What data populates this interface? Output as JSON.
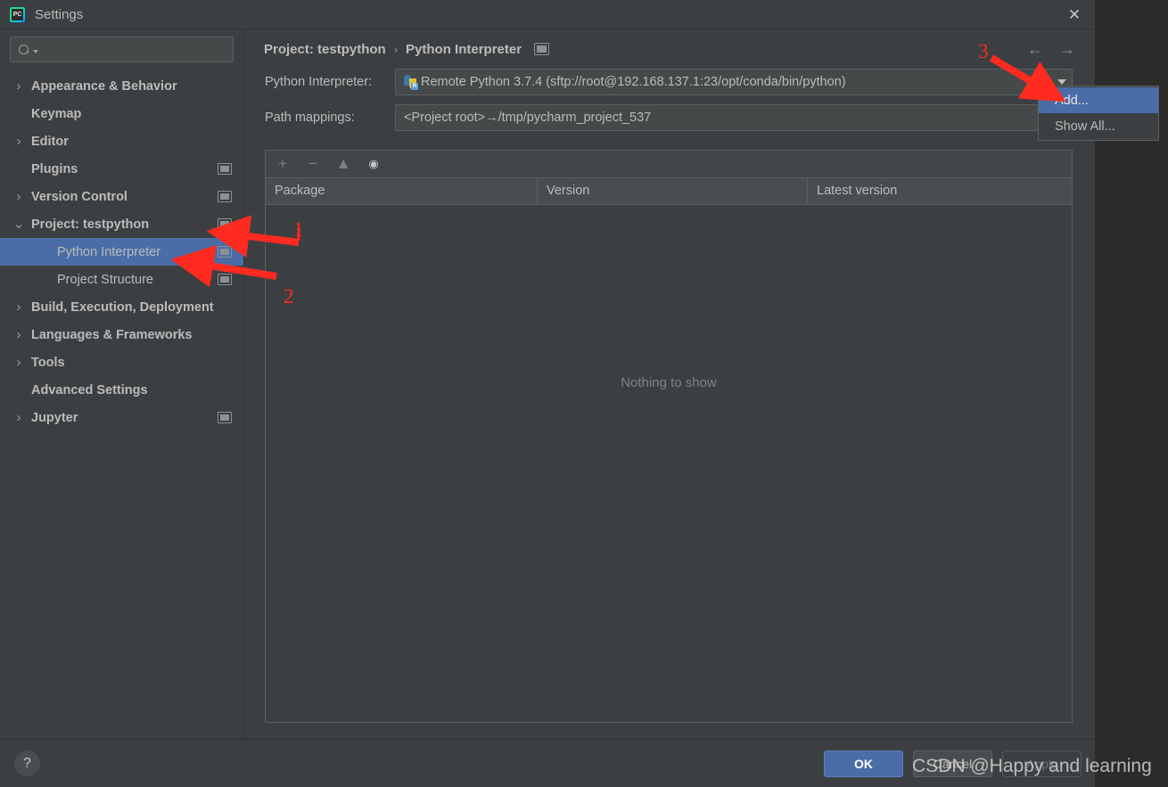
{
  "window": {
    "title": "Settings",
    "app_icon": "pycharm-icon",
    "close_icon": "close-icon"
  },
  "sidebar": {
    "search": {
      "value": "",
      "placeholder": "",
      "icon": "search-icon"
    },
    "items": [
      {
        "label": "Appearance & Behavior",
        "expandable": true,
        "expanded": false,
        "bold": true,
        "indent": 0,
        "badge": false,
        "selected": false
      },
      {
        "label": "Keymap",
        "expandable": false,
        "expanded": false,
        "bold": true,
        "indent": 0,
        "badge": false,
        "selected": false
      },
      {
        "label": "Editor",
        "expandable": true,
        "expanded": false,
        "bold": true,
        "indent": 0,
        "badge": false,
        "selected": false
      },
      {
        "label": "Plugins",
        "expandable": false,
        "expanded": false,
        "bold": true,
        "indent": 0,
        "badge": true,
        "selected": false
      },
      {
        "label": "Version Control",
        "expandable": true,
        "expanded": false,
        "bold": true,
        "indent": 0,
        "badge": true,
        "selected": false
      },
      {
        "label": "Project: testpython",
        "expandable": true,
        "expanded": true,
        "bold": true,
        "indent": 0,
        "badge": true,
        "selected": false
      },
      {
        "label": "Python Interpreter",
        "expandable": false,
        "expanded": false,
        "bold": false,
        "indent": 1,
        "badge": true,
        "selected": true
      },
      {
        "label": "Project Structure",
        "expandable": false,
        "expanded": false,
        "bold": false,
        "indent": 1,
        "badge": true,
        "selected": false
      },
      {
        "label": "Build, Execution, Deployment",
        "expandable": true,
        "expanded": false,
        "bold": true,
        "indent": 0,
        "badge": false,
        "selected": false
      },
      {
        "label": "Languages & Frameworks",
        "expandable": true,
        "expanded": false,
        "bold": true,
        "indent": 0,
        "badge": false,
        "selected": false
      },
      {
        "label": "Tools",
        "expandable": true,
        "expanded": false,
        "bold": true,
        "indent": 0,
        "badge": false,
        "selected": false
      },
      {
        "label": "Advanced Settings",
        "expandable": false,
        "expanded": false,
        "bold": true,
        "indent": 0,
        "badge": false,
        "selected": false
      },
      {
        "label": "Jupyter",
        "expandable": true,
        "expanded": false,
        "bold": true,
        "indent": 0,
        "badge": true,
        "selected": false
      }
    ]
  },
  "content": {
    "breadcrumb": {
      "project": "Project: testpython",
      "separator": "›",
      "page": "Python Interpreter"
    },
    "nav": {
      "back_icon": "arrow-left-icon",
      "forward_icon": "arrow-right-icon"
    },
    "interpreter": {
      "label": "Python Interpreter:",
      "value": "Remote Python 3.7.4 (sftp://root@192.168.137.1:23/opt/conda/bin/python)"
    },
    "path_mappings": {
      "label": "Path mappings:",
      "value": "<Project root>→/tmp/pycharm_project_537"
    },
    "packages": {
      "toolbar": [
        {
          "name": "add-package-icon",
          "glyph": "+"
        },
        {
          "name": "remove-package-icon",
          "glyph": "−"
        },
        {
          "name": "upgrade-package-icon",
          "glyph": "▲"
        },
        {
          "name": "show-early-releases-icon",
          "glyph": "◉"
        }
      ],
      "columns": [
        "Package",
        "Version",
        "Latest version"
      ],
      "rows": [],
      "empty_text": "Nothing to show"
    }
  },
  "popup": {
    "items": [
      {
        "label": "Add...",
        "highlighted": true
      },
      {
        "label": "Show All...",
        "highlighted": false
      }
    ]
  },
  "footer": {
    "help_label": "?",
    "ok_label": "OK",
    "cancel_label": "Cancel",
    "apply_label": "Apply"
  },
  "annotations": {
    "numbers": [
      "1",
      "2",
      "3"
    ],
    "color": "#ff2a20"
  },
  "watermark": {
    "text": "CSDN @Happy and learning"
  },
  "colors": {
    "window_bg": "#3c3f41",
    "desktop_bg": "#2b2b2b",
    "selection_blue": "#4a6da7",
    "text": "#bbbbbb",
    "border": "#5e6060",
    "annotation_red": "#ff2a20"
  }
}
